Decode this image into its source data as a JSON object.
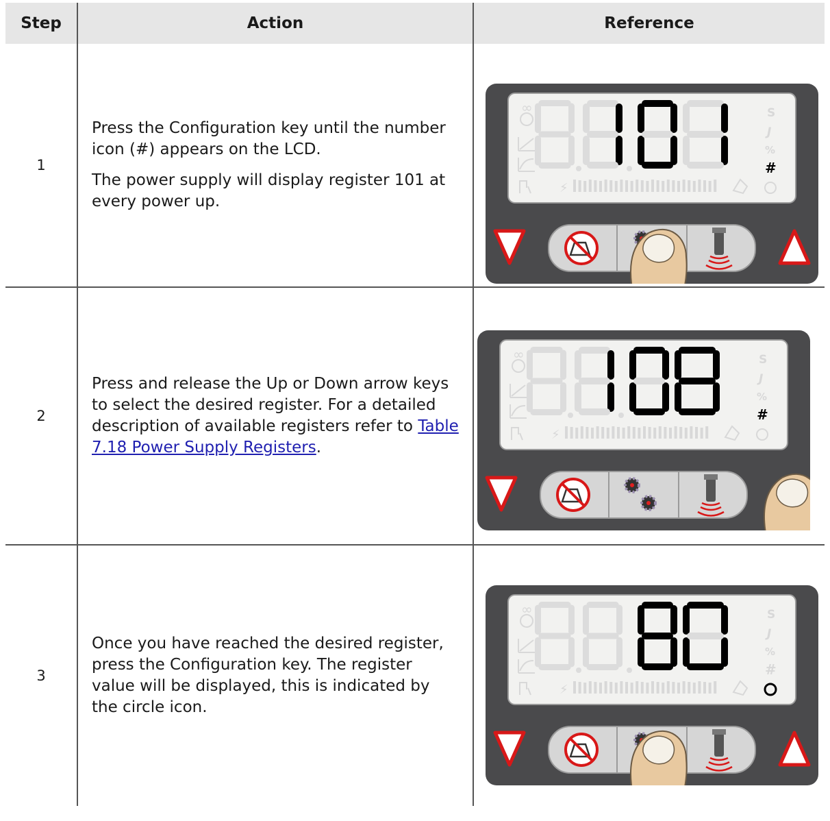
{
  "table": {
    "headers": [
      "Step",
      "Action",
      "Reference"
    ],
    "rows": [
      {
        "step": "1",
        "action_p1": "Press the Configuration key until the number icon (#) appears on the LCD.",
        "action_p2": "The power supply will display register 101 at every power up.",
        "display_digits": "101",
        "display_icon": "#",
        "pressed_key": "configuration"
      },
      {
        "step": "2",
        "action_text": "Press and release the Up or Down arrow keys to select the desired register. For a detailed description of available registers refer to ",
        "action_link": "Table 7.18 Power Supply Registers",
        "action_tail": ".",
        "display_digits": "108",
        "display_icon": "#",
        "pressed_key": "up-arrow"
      },
      {
        "step": "3",
        "action_text": "Once you have reached the desired register, press the Configuration key. The register value will be displayed, this is indicated by the circle icon.",
        "display_digits": "80",
        "display_icon": "O",
        "pressed_key": "configuration"
      }
    ]
  }
}
